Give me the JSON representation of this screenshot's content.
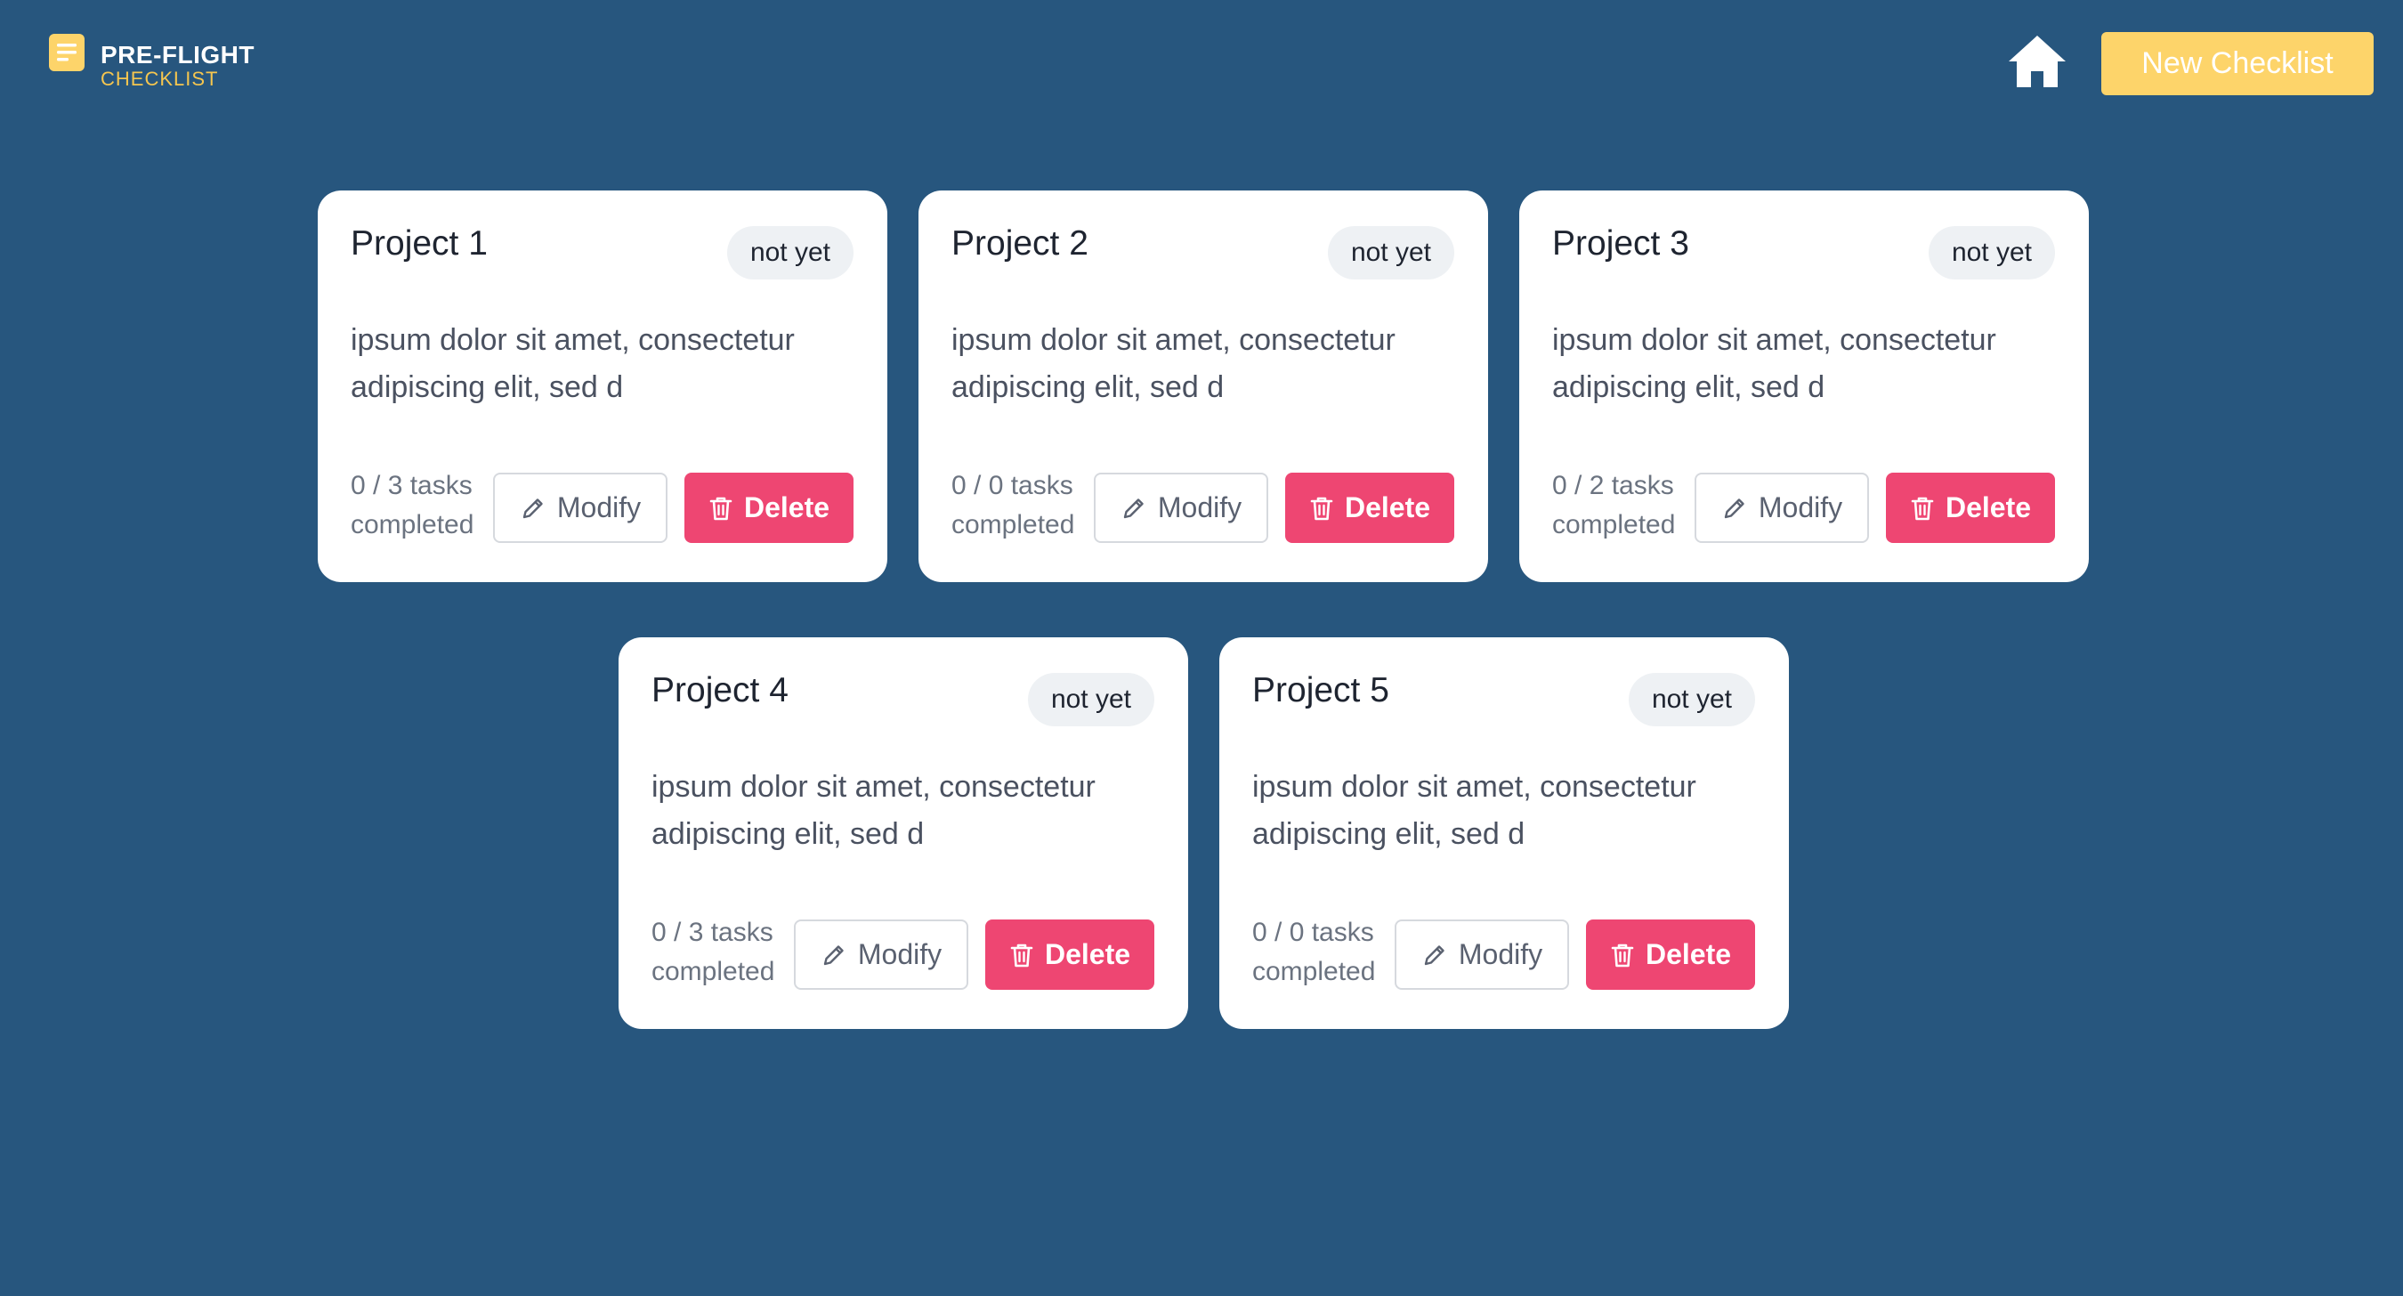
{
  "app": {
    "logo_line1": "PRE-FLIGHT",
    "logo_line2": "CHECKLIST",
    "logo_icon": "document-icon",
    "home_icon": "home-icon",
    "new_button_label": "New Checklist"
  },
  "colors": {
    "background": "#27567e",
    "accent": "#fdd46a",
    "delete": "#ee4672",
    "card": "#ffffff",
    "badge": "#eef1f4"
  },
  "projects": [
    {
      "title": "Project 1",
      "status": "not yet",
      "description": "ipsum dolor sit amet, consectetur adipiscing elit, sed d",
      "progress_line1": "0 / 3 tasks",
      "progress_line2": "completed",
      "modify_label": "Modify",
      "delete_label": "Delete"
    },
    {
      "title": "Project 2",
      "status": "not yet",
      "description": "ipsum dolor sit amet, consectetur adipiscing elit, sed d",
      "progress_line1": "0 / 0 tasks",
      "progress_line2": "completed",
      "modify_label": "Modify",
      "delete_label": "Delete"
    },
    {
      "title": "Project 3",
      "status": "not yet",
      "description": "ipsum dolor sit amet, consectetur adipiscing elit, sed d",
      "progress_line1": "0 / 2 tasks",
      "progress_line2": "completed",
      "modify_label": "Modify",
      "delete_label": "Delete"
    },
    {
      "title": "Project 4",
      "status": "not yet",
      "description": "ipsum dolor sit amet, consectetur adipiscing elit, sed d",
      "progress_line1": "0 / 3 tasks",
      "progress_line2": "completed",
      "modify_label": "Modify",
      "delete_label": "Delete"
    },
    {
      "title": "Project 5",
      "status": "not yet",
      "description": "ipsum dolor sit amet, consectetur adipiscing elit, sed d",
      "progress_line1": "0 / 0 tasks",
      "progress_line2": "completed",
      "modify_label": "Modify",
      "delete_label": "Delete"
    }
  ]
}
